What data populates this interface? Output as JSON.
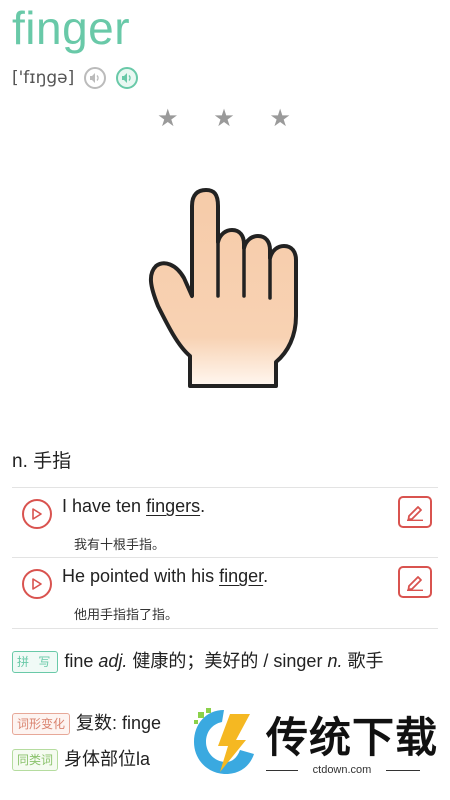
{
  "word": "finger",
  "phonetic": "['fɪŋgə]",
  "speaker_icons": [
    "speaker-icon",
    "speaker-icon"
  ],
  "stars": "★ ★ ★",
  "definition": "n. 手指",
  "examples": [
    {
      "pre": "I have ten ",
      "key": "fingers",
      "post": ".",
      "zh": "我有十根手指。"
    },
    {
      "pre": "He pointed with his ",
      "key": "finger",
      "post": ".",
      "zh": "他用手指指了指。"
    }
  ],
  "info": {
    "spelling": {
      "tag": "拼 写",
      "t1": "fine ",
      "p1": "adj.",
      "t2": " 健康的；美好的 / singer ",
      "p2": "n.",
      "t3": " 歌手"
    },
    "morph": {
      "tag": "词形变化",
      "text": "复数: finge"
    },
    "similar": {
      "tag": "同类词",
      "text": "身体部位la"
    }
  },
  "watermark": {
    "title": "传统下载",
    "sub": "ctdown.com"
  },
  "colors": {
    "accent": "#69c9a8",
    "red": "#d9534f"
  }
}
